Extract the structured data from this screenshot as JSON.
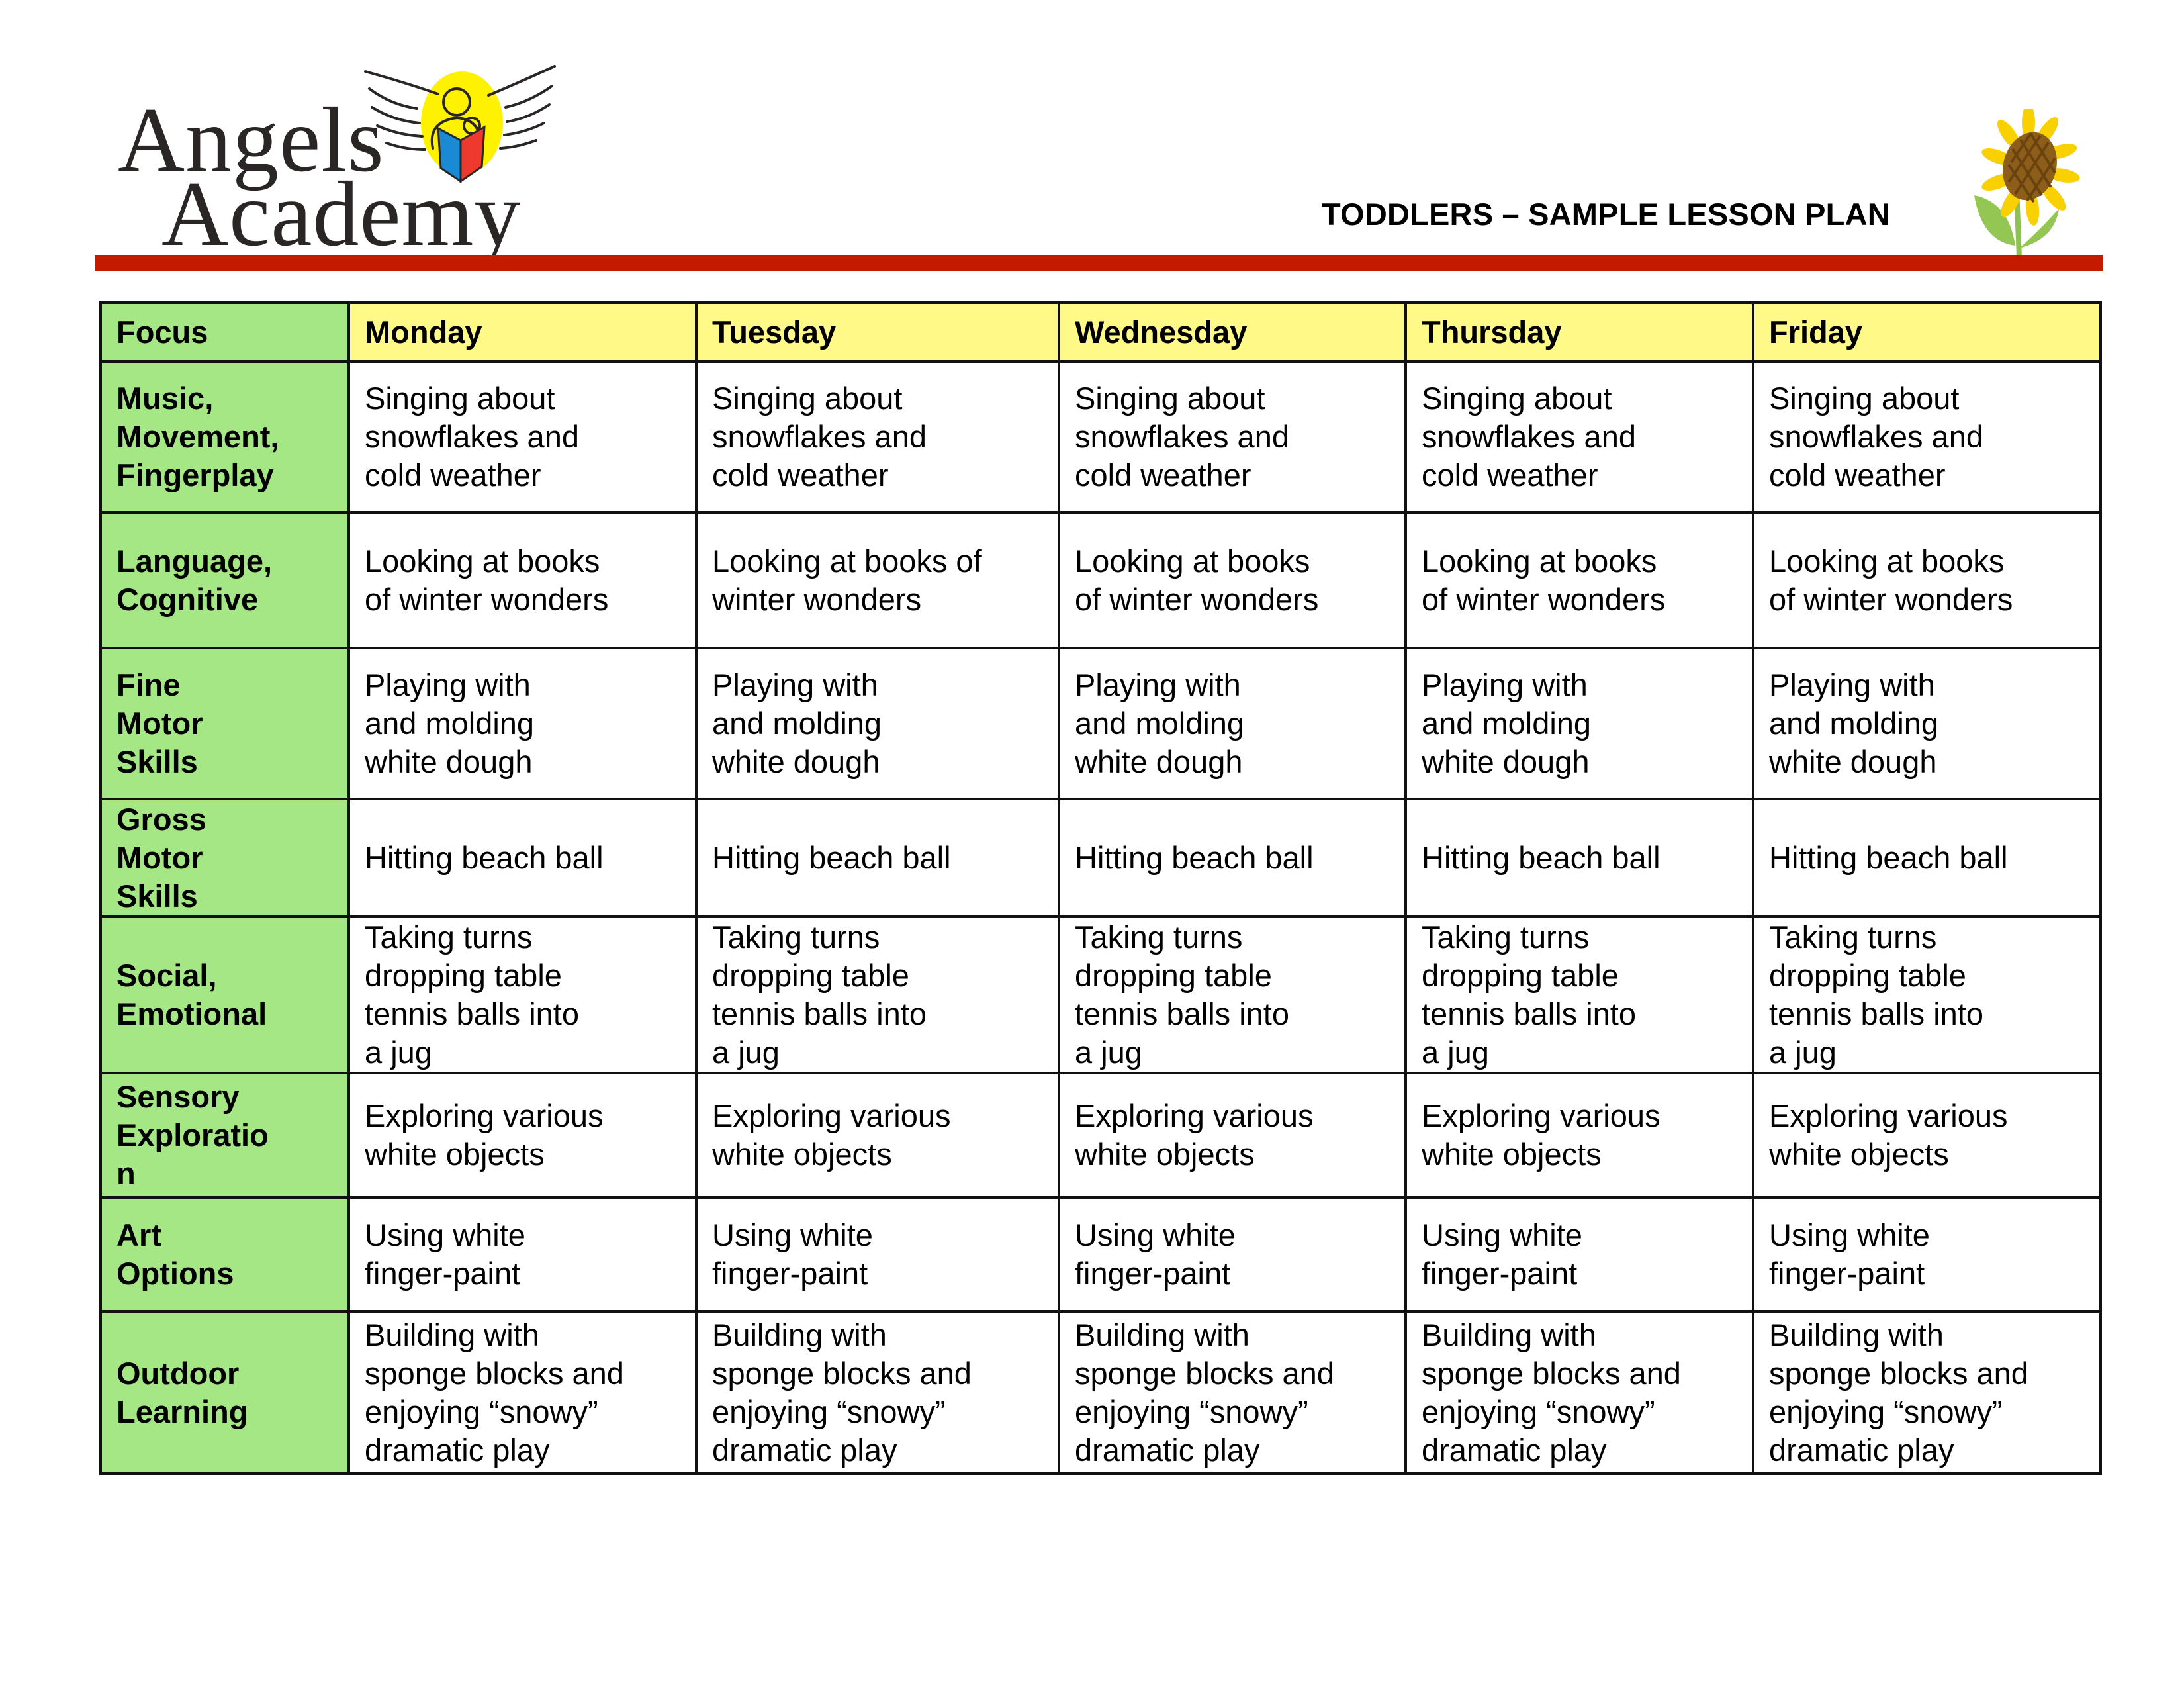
{
  "logo": {
    "line1": "Angels",
    "line2": "Academy",
    "emblem_icon": "angel-reading-book-icon",
    "colors": {
      "halo": "#fff200",
      "book_left": "#1a8ad4",
      "book_right": "#ee3a2e",
      "text": "#2b2626"
    }
  },
  "header": {
    "title": "TODDLERS – SAMPLE LESSON PLAN",
    "decoration_icon": "sunflower-icon",
    "rule_color": "#c41b00"
  },
  "table": {
    "colors": {
      "focus_bg": "#a6e785",
      "day_header_bg": "#fff988"
    },
    "columns": [
      "Focus",
      "Monday",
      "Tuesday",
      "Wednesday",
      "Thursday",
      "Friday"
    ],
    "rows": [
      {
        "focus": "Music,\nMovement,\nFingerplay",
        "cells": [
          "Singing about\nsnowflakes and\ncold weather",
          "Singing about\nsnowflakes and\ncold weather",
          "Singing about\nsnowflakes and\ncold weather",
          "Singing about\nsnowflakes and\ncold weather",
          "Singing about\nsnowflakes and\ncold weather"
        ]
      },
      {
        "focus": "Language,\nCognitive",
        "cells": [
          "Looking at books\nof winter wonders",
          "Looking at books of\nwinter wonders",
          "Looking at books\nof winter wonders",
          "Looking at books\nof winter wonders",
          "Looking at books\nof winter wonders"
        ]
      },
      {
        "focus": "Fine\nMotor\nSkills",
        "cells": [
          "Playing with\nand molding\nwhite dough",
          "Playing with\nand molding\nwhite dough",
          "Playing with\nand molding\nwhite dough",
          "Playing with\nand molding\nwhite dough",
          "Playing with\nand molding\nwhite dough"
        ]
      },
      {
        "focus": "Gross\nMotor\nSkills",
        "cells": [
          "Hitting beach ball",
          "Hitting beach ball",
          "Hitting beach ball",
          "Hitting beach ball",
          "Hitting beach ball"
        ]
      },
      {
        "focus": "Social,\nEmotional",
        "cells": [
          "Taking turns\ndropping table\ntennis balls into\na jug",
          "Taking turns\ndropping table\ntennis balls into\na jug",
          "Taking turns\ndropping table\ntennis balls into\na jug",
          "Taking turns\ndropping table\ntennis balls into\na jug",
          "Taking turns\ndropping table\ntennis balls into\na jug"
        ]
      },
      {
        "focus": "Sensory\nExploratio\nn",
        "cells": [
          "Exploring various\nwhite objects",
          "Exploring various\nwhite objects",
          "Exploring various\nwhite objects",
          "Exploring various\nwhite objects",
          "Exploring various\nwhite objects"
        ]
      },
      {
        "focus": "Art\nOptions",
        "cells": [
          "Using white\nfinger-paint",
          "Using white\nfinger-paint",
          "Using white\nfinger-paint",
          "Using white\nfinger-paint",
          "Using white\nfinger-paint"
        ]
      },
      {
        "focus": "Outdoor\nLearning",
        "cells": [
          "Building with\nsponge blocks and\nenjoying “snowy”\ndramatic play",
          "Building with\nsponge blocks and\nenjoying “snowy”\ndramatic play",
          "Building with\nsponge blocks and\nenjoying “snowy”\ndramatic play",
          "Building with\nsponge blocks and\nenjoying “snowy”\ndramatic play",
          "Building with\nsponge blocks and\nenjoying “snowy”\ndramatic play"
        ]
      }
    ]
  }
}
